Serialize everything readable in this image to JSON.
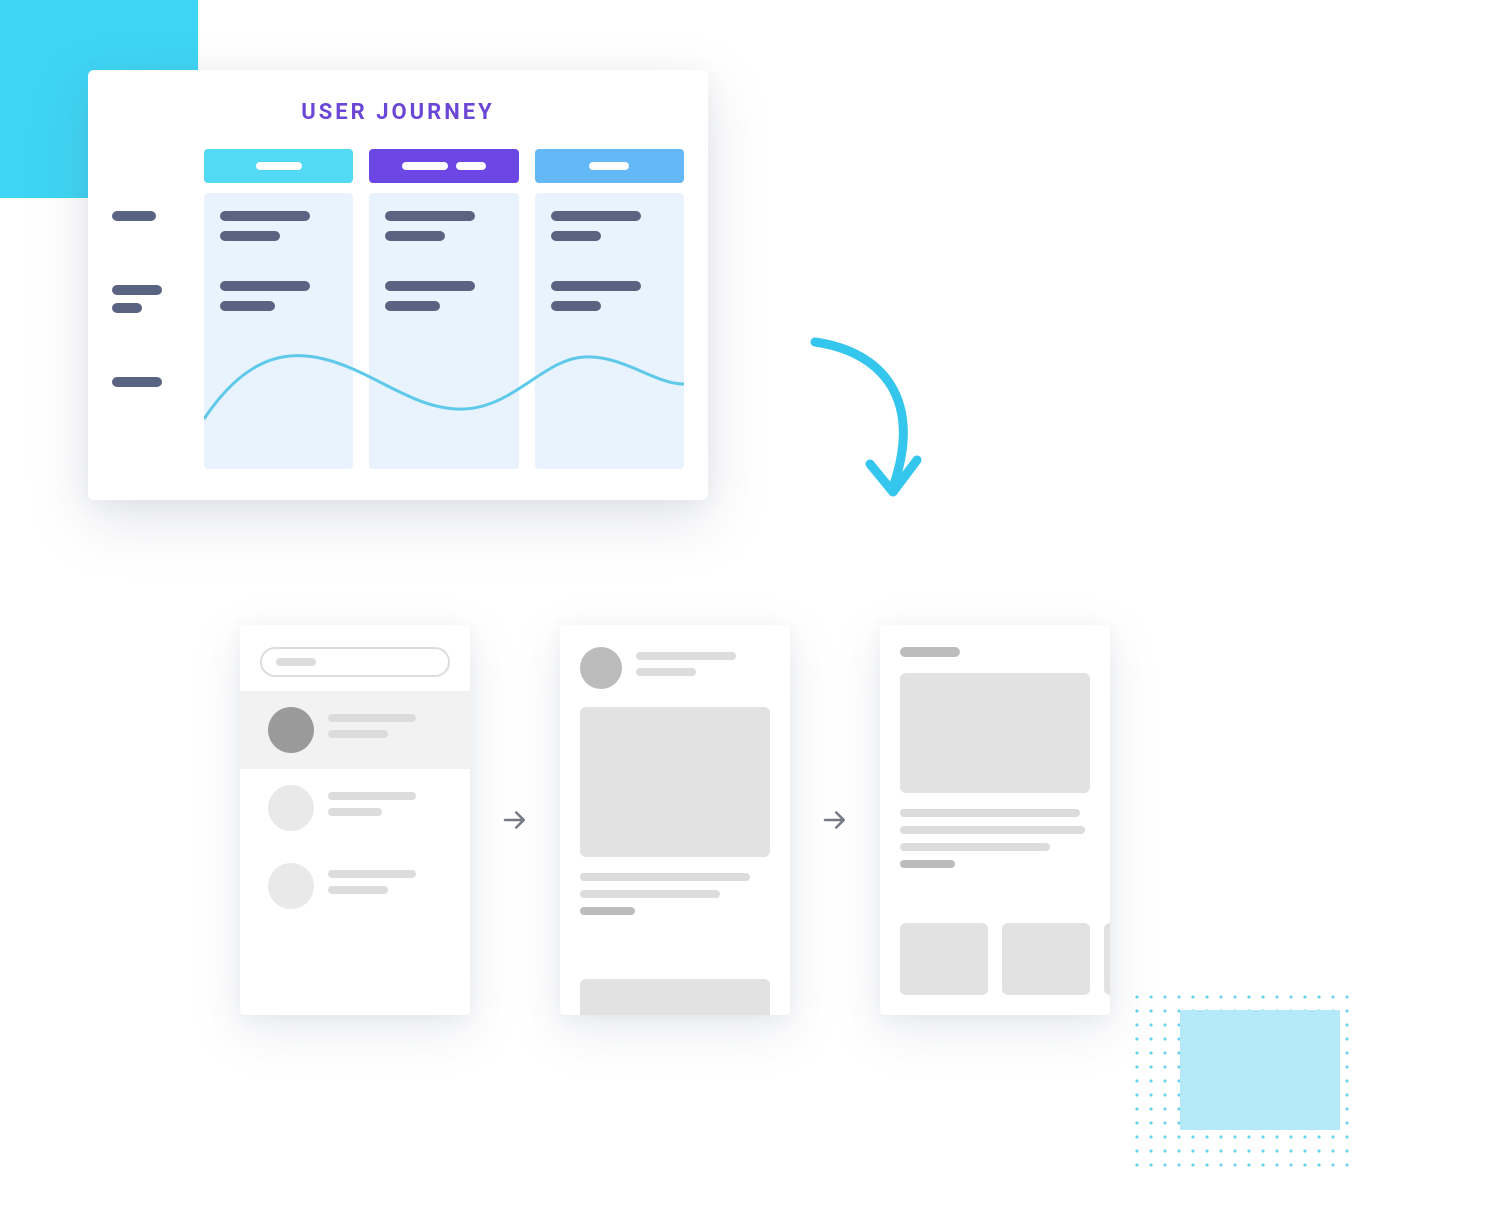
{
  "journey": {
    "title": "USER JOURNEY",
    "columns": [
      {
        "header_color": "#52d9f4",
        "pill_widths": [
          46
        ]
      },
      {
        "header_color": "#6d47e5",
        "pill_widths": [
          46,
          30
        ]
      },
      {
        "header_color": "#65b8f6",
        "pill_widths": [
          40
        ]
      }
    ],
    "wave_color": "#5ec9e8"
  },
  "arrow": {
    "color": "#34c6ec"
  },
  "wireframes": {
    "step_arrow_color": "#777a85",
    "card1": {
      "search_placeholder_width": 40,
      "avatar_selected": "#9a9a9a",
      "avatar_default": "#e2e2e2"
    },
    "card2": {},
    "card3": {}
  },
  "colors": {
    "deco_cyan": "#3ed5f4",
    "accent_purple": "#6b47d6",
    "line_dark": "#5b6382",
    "panel_blue": "#e8f3fd",
    "gray_placeholder": "#dcdcdc",
    "gray_block": "#e2e2e2",
    "gray_dark": "#bcbcbc"
  }
}
